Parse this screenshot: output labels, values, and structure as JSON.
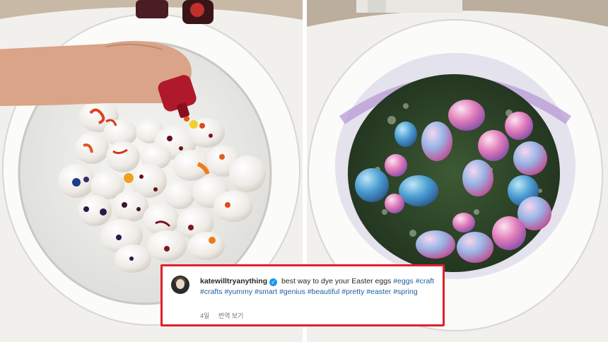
{
  "post": {
    "username": "katewilltryanything",
    "verified_icon": "verified-badge-icon",
    "caption_text": "best way to dye your Easter eggs",
    "hashtags": [
      "#eggs",
      "#craft",
      "#crafts",
      "#yummy",
      "#smart",
      "#genius",
      "#beautiful",
      "#pretty",
      "#easter",
      "#spring"
    ],
    "time_ago": "4일",
    "translate_label": "번역 보기"
  },
  "colors": {
    "highlight_border": "#e0212b",
    "hashtag_blue": "#1e5fa0",
    "verified_blue": "#1c96f0",
    "toilet_white": "#f4f4f2",
    "water_green": "#2e4a2a"
  },
  "images": {
    "left_panel_icon": "toilet-eggs-before-photo",
    "right_panel_icon": "toilet-eggs-dyed-photo"
  }
}
